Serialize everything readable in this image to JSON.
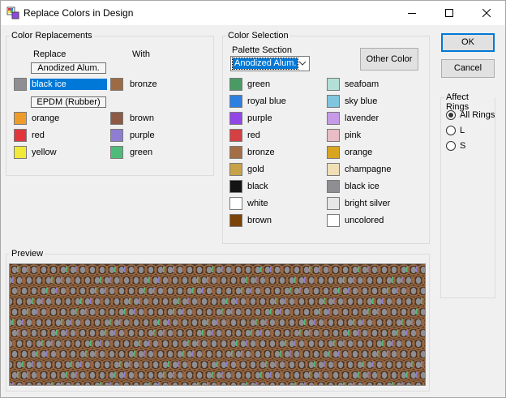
{
  "window": {
    "title": "Replace Colors in Design"
  },
  "color_replacements": {
    "title": "Color Replacements",
    "col_replace": "Replace",
    "col_with": "With",
    "anodized_label": "Anodized Alum.",
    "epdm_label": "EPDM (Rubber)",
    "anodized_rows": [
      {
        "from": "black ice",
        "from_color": "#8e8e93",
        "to": "bronze",
        "to_color": "#9c6b43",
        "selected": true
      }
    ],
    "epdm_rows": [
      {
        "from": "orange",
        "from_color": "#ee9b2b",
        "to": "brown",
        "to_color": "#8c5a45"
      },
      {
        "from": "red",
        "from_color": "#e2363d",
        "to": "purple",
        "to_color": "#8e7dd0"
      },
      {
        "from": "yellow",
        "from_color": "#f3e93a",
        "to": "green",
        "to_color": "#4fbb7b"
      }
    ]
  },
  "color_selection": {
    "title": "Color Selection",
    "palette_label": "Palette Section",
    "palette_value": "Anodized Alum.",
    "other_color_button": "Other Color",
    "left_colors": [
      {
        "name": "green",
        "color": "#4a9a63"
      },
      {
        "name": "royal blue",
        "color": "#2d7fe0"
      },
      {
        "name": "purple",
        "color": "#9146e5"
      },
      {
        "name": "red",
        "color": "#d44043"
      },
      {
        "name": "bronze",
        "color": "#a36e46"
      },
      {
        "name": "gold",
        "color": "#c7a248"
      },
      {
        "name": "black",
        "color": "#141414"
      },
      {
        "name": "white",
        "color": "#ffffff"
      },
      {
        "name": "brown",
        "color": "#7b4305"
      }
    ],
    "right_colors": [
      {
        "name": "seafoam",
        "color": "#b3e0d6"
      },
      {
        "name": "sky blue",
        "color": "#7fc5dd"
      },
      {
        "name": "lavender",
        "color": "#c79ae8"
      },
      {
        "name": "pink",
        "color": "#e8bdc6"
      },
      {
        "name": "orange",
        "color": "#d9a521"
      },
      {
        "name": "champagne",
        "color": "#f0dfb6"
      },
      {
        "name": "black ice",
        "color": "#8e8e93"
      },
      {
        "name": "bright silver",
        "color": "#e6e6e6"
      },
      {
        "name": "uncolored",
        "color": "#ffffff"
      }
    ]
  },
  "buttons": {
    "ok": "OK",
    "cancel": "Cancel"
  },
  "affect_rings": {
    "title": "Affect Rings",
    "options": [
      {
        "label": "All Rings",
        "checked": true
      },
      {
        "label": "L",
        "checked": false
      },
      {
        "label": "S",
        "checked": false
      }
    ]
  },
  "preview": {
    "title": "Preview"
  }
}
